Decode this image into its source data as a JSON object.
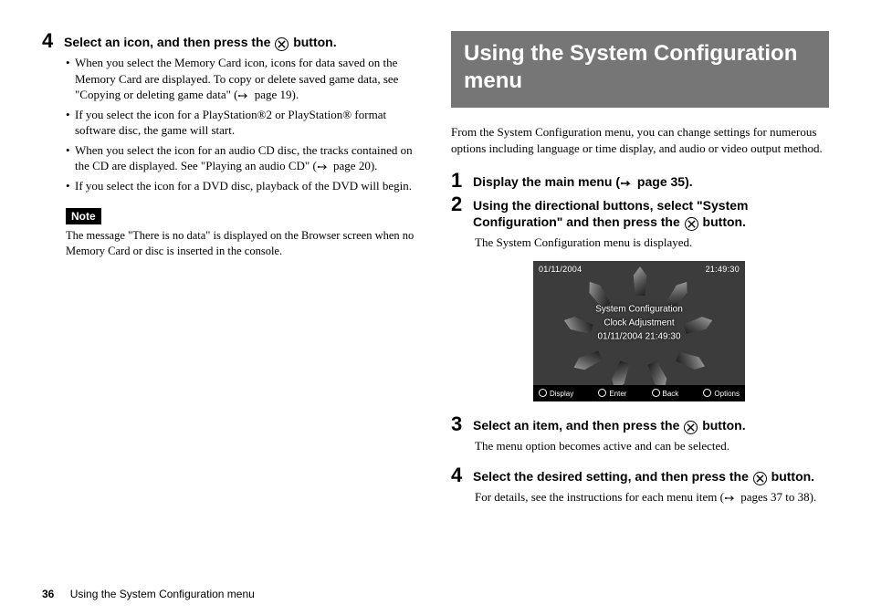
{
  "icons": {
    "x_button_alt": "X (cross) button",
    "page_ref_alt": "page reference arrow"
  },
  "left": {
    "step4": {
      "num": "4",
      "head_a": "Select an icon, and then press the ",
      "head_b": " button.",
      "bullets": [
        {
          "a": "When you select the Memory Card icon, icons for data saved on the Memory Card are displayed. To copy or delete saved game data, see \"Copying or deleting game data\" (",
          "b": " page 19)."
        },
        {
          "a": "If you select the icon for a PlayStation®2 or PlayStation® format software disc, the game will start.",
          "b": ""
        },
        {
          "a": "When you select the icon for an audio CD disc, the tracks contained on the CD are displayed. See \"Playing an audio CD\" (",
          "b": " page 20)."
        },
        {
          "a": "If you select the icon for a DVD disc, playback of the DVD will begin.",
          "b": ""
        }
      ]
    },
    "note_label": "Note",
    "note_text": "The message \"There is no data\" is displayed on the Browser screen when no Memory Card or disc is inserted in the console."
  },
  "right": {
    "title": "Using the System Configuration menu",
    "intro": "From the System Configuration menu, you can change settings for numerous options including language or time display, and audio or video output method.",
    "step1": {
      "num": "1",
      "head_a": "Display the main menu (",
      "head_b": " page 35)."
    },
    "step2": {
      "num": "2",
      "head_a": "Using the directional buttons, select \"System Configuration\" and then press the ",
      "head_b": " button.",
      "body": "The System Configuration menu is displayed."
    },
    "screenshot": {
      "date": "01/11/2004",
      "time": "21:49:30",
      "line1": "System Configuration",
      "line2": "Clock Adjustment",
      "line3": "01/11/2004 21:49:30",
      "bar": {
        "a": "Display",
        "b": "Enter",
        "c": "Back",
        "d": "Options"
      }
    },
    "step3": {
      "num": "3",
      "head_a": "Select an item, and then press the ",
      "head_b": " button.",
      "body": "The menu option becomes active and can be selected."
    },
    "step4": {
      "num": "4",
      "head_a": "Select the desired setting, and then press the ",
      "head_b": " button.",
      "body_a": "For details, see the instructions for each menu item (",
      "body_b": " pages 37 to 38)."
    }
  },
  "footer": {
    "page": "36",
    "title": "Using the System Configuration menu"
  }
}
